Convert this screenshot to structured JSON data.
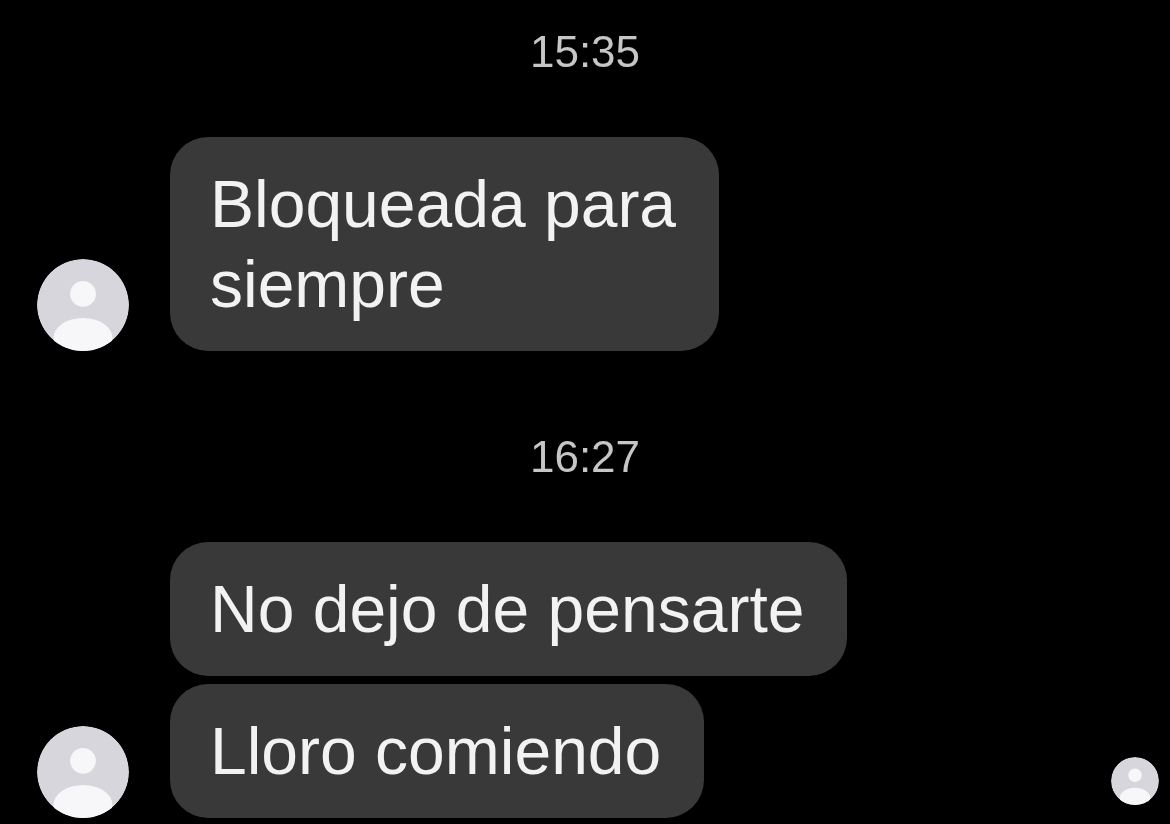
{
  "conversation": [
    {
      "time": "15:35",
      "messages": [
        {
          "text": "Bloqueada para siempre",
          "show_avatar": true,
          "seen": false
        }
      ]
    },
    {
      "time": "16:27",
      "messages": [
        {
          "text": "No dejo de pensarte",
          "show_avatar": false,
          "seen": false
        },
        {
          "text": "Lloro comiendo",
          "show_avatar": true,
          "seen": true
        }
      ]
    }
  ]
}
